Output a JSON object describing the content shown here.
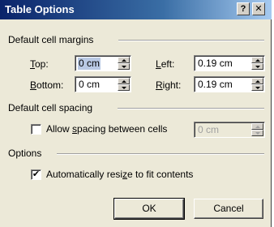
{
  "window": {
    "title": "Table Options",
    "help_glyph": "?",
    "close_glyph": "✕"
  },
  "margins": {
    "group_label": "Default cell margins",
    "top": {
      "label_key": "T",
      "label_rest": "op:",
      "value": "0 cm"
    },
    "bottom": {
      "label_key": "B",
      "label_rest": "ottom:",
      "value": "0 cm"
    },
    "left": {
      "label_key": "L",
      "label_rest": "eft:",
      "value": "0.19 cm"
    },
    "right": {
      "label_key": "R",
      "label_rest": "ight:",
      "value": "0.19 cm"
    }
  },
  "spacing": {
    "group_label": "Default cell spacing",
    "checkbox_pre": "Allow ",
    "checkbox_key": "s",
    "checkbox_post": "pacing between cells",
    "checked": false,
    "value": "0 cm"
  },
  "options": {
    "group_label": "Options",
    "checkbox_pre": "Automatically resi",
    "checkbox_key": "z",
    "checkbox_post": "e to fit contents",
    "checked": true,
    "check_glyph": "✔"
  },
  "buttons": {
    "ok": "OK",
    "cancel": "Cancel"
  }
}
